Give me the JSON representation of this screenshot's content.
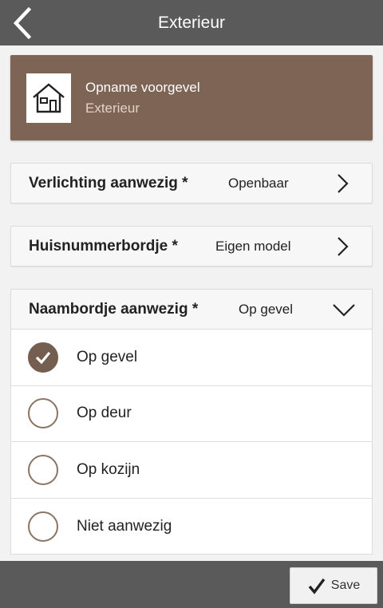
{
  "topbar": {
    "title": "Exterieur",
    "back_icon": "chevron-left-icon"
  },
  "header": {
    "title": "Opname voorgevel",
    "subtitle": "Exterieur",
    "icon": "house-icon",
    "color": "#7d6454"
  },
  "fields": [
    {
      "label": "Verlichting aanwezig *",
      "value": "Openbaar",
      "icon": "chevron-right-icon"
    },
    {
      "label": "Huisnummerbordje *",
      "value": "Eigen model",
      "icon": "chevron-right-icon"
    },
    {
      "label": "Naambordje aanwezig *",
      "value": "Op gevel",
      "icon": "chevron-down-icon"
    }
  ],
  "options": [
    {
      "label": "Op gevel",
      "checked": true
    },
    {
      "label": "Op deur",
      "checked": false
    },
    {
      "label": "Op kozijn",
      "checked": false
    },
    {
      "label": "Niet aanwezig",
      "checked": false
    }
  ],
  "footer": {
    "save_label": "Save",
    "save_icon": "checkmark-icon"
  },
  "colors": {
    "bar": "#5a5a5a",
    "accent": "#745e4f"
  }
}
